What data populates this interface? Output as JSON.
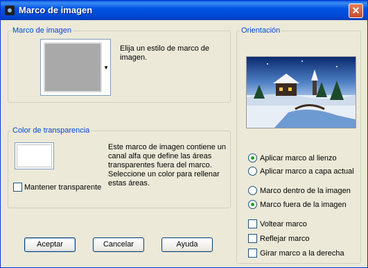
{
  "window": {
    "title": "Marco de imagen",
    "close_glyph": "✕"
  },
  "frame_group": {
    "legend": "Marco de imagen",
    "description": "Elija un estilo de marco de imagen.",
    "dropdown_glyph": "▼"
  },
  "transparency_group": {
    "legend": "Color de transparencia",
    "description": "Este marco de imagen contiene un canal alfa que define las áreas transparentes fuera del marco. Seleccione un color para rellenar estas áreas.",
    "keep_transparent_label": "Mantener transparente",
    "keep_transparent_checked": false,
    "swatch_color": "#FFFFFF"
  },
  "orientation_group": {
    "legend": "Orientación",
    "apply_canvas_label": "Aplicar marco al lienzo",
    "apply_canvas_selected": true,
    "apply_layer_label": "Aplicar marco a capa actual",
    "apply_layer_selected": false,
    "frame_inside_label": "Marco dentro de la imagen",
    "frame_inside_selected": false,
    "frame_outside_label": "Marco fuera de la imagen",
    "frame_outside_selected": true,
    "flip_label": "Voltear marco",
    "flip_checked": false,
    "mirror_label": "Reflejar marco",
    "mirror_checked": false,
    "rotate_label": "Girar marco a la derecha",
    "rotate_checked": false
  },
  "buttons": {
    "ok": "Aceptar",
    "cancel": "Cancelar",
    "help": "Ayuda"
  },
  "colors": {
    "title_bar": "#0054E3",
    "dialog_bg": "#ECE9D8",
    "legend_text": "#0046D5",
    "radio_dot": "#21A121"
  }
}
